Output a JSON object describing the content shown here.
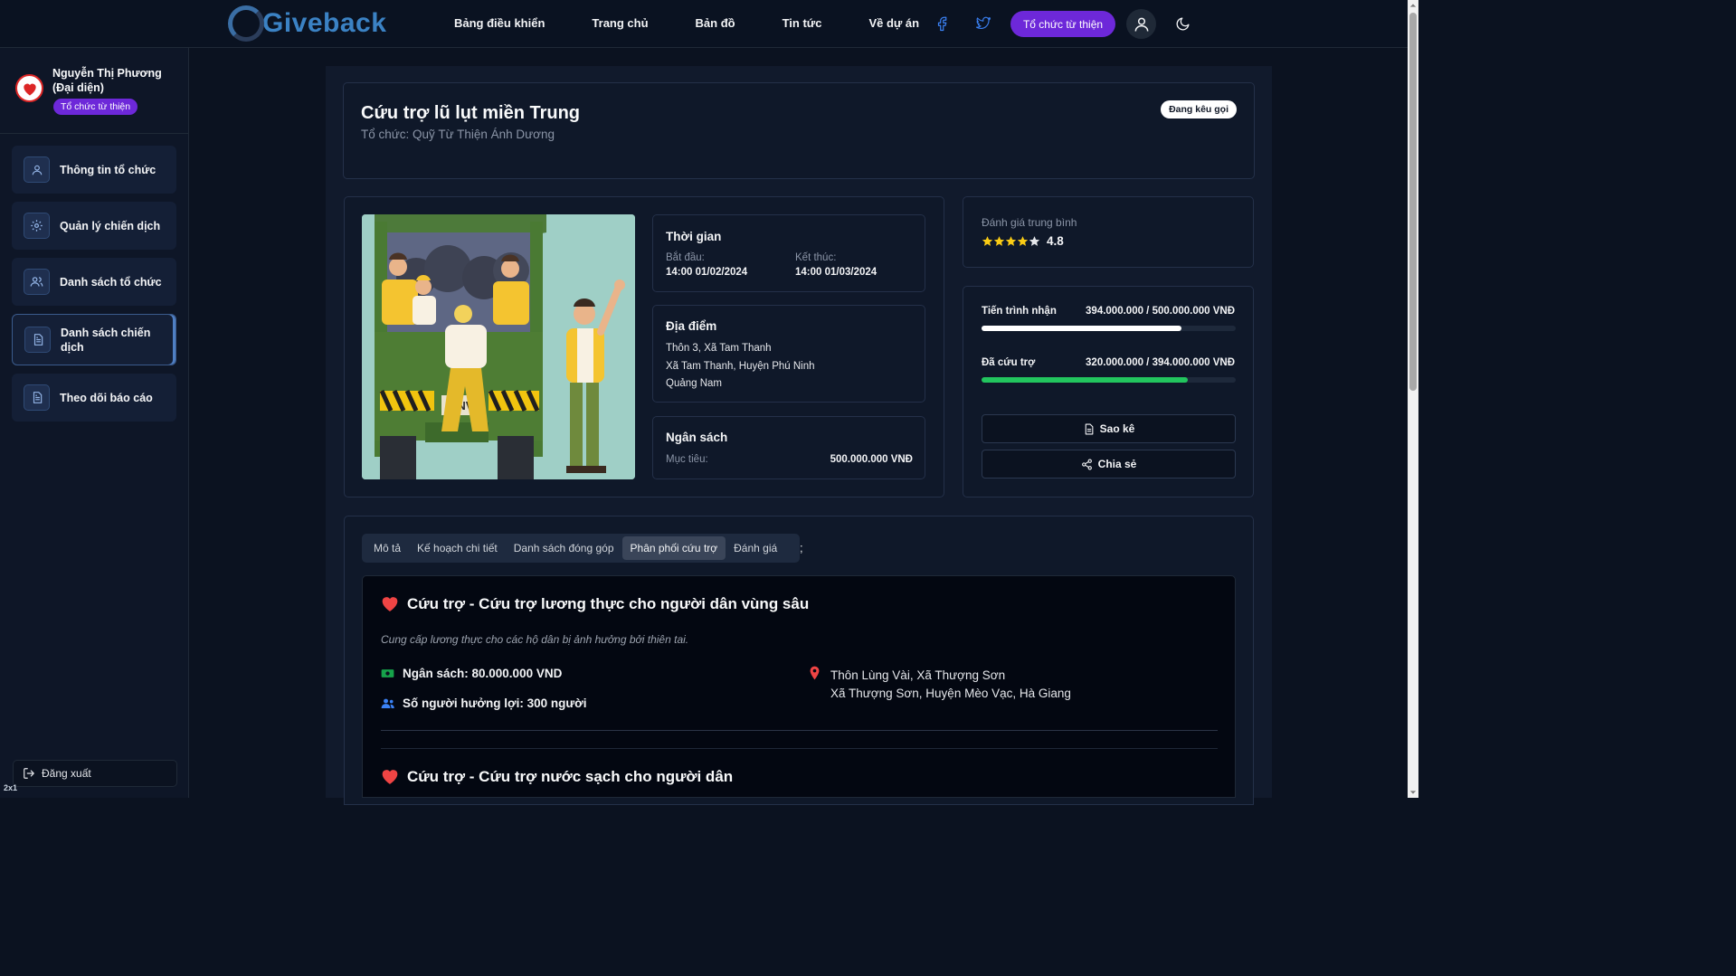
{
  "brand": {
    "name": "Giveback"
  },
  "nav": {
    "links": [
      "Bảng điều khiển",
      "Trang chủ",
      "Bản đồ",
      "Tin tức",
      "Về dự án"
    ],
    "org_button": "Tổ chức từ thiện"
  },
  "sidebar": {
    "user_name": "Nguyễn Thị Phương (Đại diện)",
    "user_role": "Tổ chức từ thiện",
    "items": [
      {
        "label": "Thông tin tổ chức",
        "icon": "user-icon"
      },
      {
        "label": "Quản lý chiến dịch",
        "icon": "gear-icon"
      },
      {
        "label": "Danh sách tổ chức",
        "icon": "users-icon"
      },
      {
        "label": "Danh sách chiến dịch",
        "icon": "document-icon"
      },
      {
        "label": "Theo dõi báo cáo",
        "icon": "document-icon"
      }
    ],
    "active_index": 3,
    "logout": "Đăng xuất",
    "corner_tag": "2x1"
  },
  "campaign": {
    "title": "Cứu trợ lũ lụt miền Trung",
    "organization": "Tổ chức: Quỹ Từ Thiện Ánh Dương",
    "status": "Đang kêu gọi"
  },
  "time": {
    "heading": "Thời gian",
    "start_label": "Bắt đầu:",
    "start_value": "14:00 01/02/2024",
    "end_label": "Kết thúc:",
    "end_value": "14:00 01/03/2024"
  },
  "location": {
    "heading": "Địa điểm",
    "line1": "Thôn 3, Xã Tam Thanh",
    "line2": "Xã Tam Thanh, Huyện Phú Ninh",
    "line3": "Quảng Nam"
  },
  "budget": {
    "heading": "Ngân sách",
    "target_label": "Mục tiêu:",
    "target_value": "500.000.000 VNĐ"
  },
  "rating": {
    "label": "Đánh giá trung bình",
    "value": "4.8",
    "stars": 4.8
  },
  "progress": {
    "received_label": "Tiến trình nhận",
    "received_value": "394.000.000 / 500.000.000 VNĐ",
    "received_fraction": 0.788,
    "relief_label": "Đã cứu trợ",
    "relief_value": "320.000.000 / 394.000.000 VNĐ",
    "relief_fraction": 0.812
  },
  "actions": {
    "statement": "Sao kê",
    "share": "Chia sẻ"
  },
  "tabs": {
    "items": [
      "Mô tả",
      "Kế hoạch chi tiết",
      "Danh sách đóng góp",
      "Phân phối cứu trợ",
      "Đánh giá"
    ],
    "active_index": 3,
    "trailing": ";"
  },
  "distributions": [
    {
      "title": "Cứu trợ - Cứu trợ lương thực cho người dân vùng sâu",
      "description": "Cung cấp lương thực cho các hộ dân bị ảnh hưởng bởi thiên tai.",
      "budget": "Ngân sách: 80.000.000 VND",
      "beneficiaries": "Số người hưởng lợi: 300 người",
      "location_line1": "Thôn Lùng Vài, Xã Thượng Sơn",
      "location_line2": "Xã Thượng Sơn, Huyện Mèo Vạc, Hà Giang"
    },
    {
      "title": "Cứu trợ - Cứu trợ nước sạch cho người dân"
    }
  ],
  "colors": {
    "accent_purple": "#6d28d9",
    "progress_white": "#ffffff",
    "progress_green": "#22c55e",
    "heart_red": "#ef4444"
  }
}
